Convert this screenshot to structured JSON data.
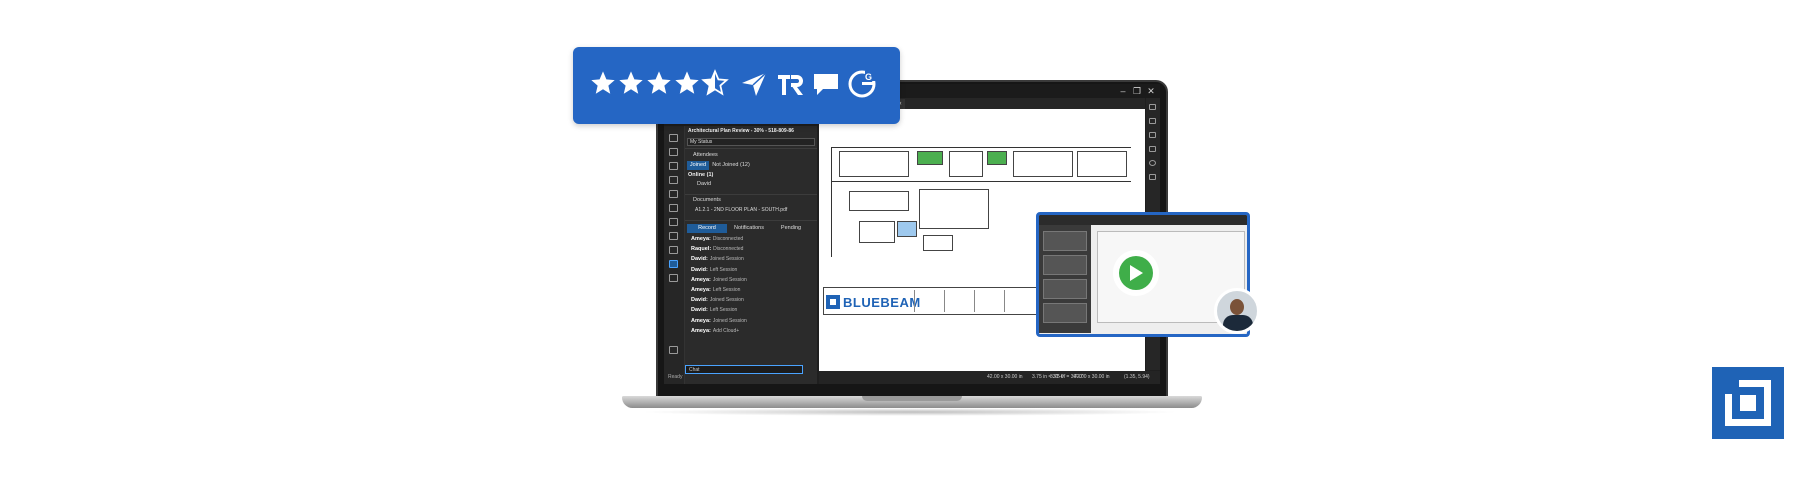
{
  "app": {
    "session_title": "Architectural Plan Review - 30% - 518-809-86",
    "status_label": "My Status",
    "status_text": "Ready"
  },
  "attendees": {
    "header": "Attendees",
    "tabs": [
      "Joined",
      "Not Joined (12)"
    ],
    "online_header": "Online (1)",
    "online_users": [
      "David"
    ]
  },
  "documents": {
    "header": "Documents",
    "items": [
      "A1.2.1 - 2ND FLOOR PLAN - SOUTH.pdf"
    ]
  },
  "record": {
    "tabs": [
      "Record",
      "Notifications",
      "Pending"
    ],
    "entries": [
      {
        "name": "Ameya:",
        "action": "Disconnected"
      },
      {
        "name": "Raquel:",
        "action": "Disconnected"
      },
      {
        "name": "David:",
        "action": "Joined Session"
      },
      {
        "name": "David:",
        "action": "Left Session"
      },
      {
        "name": "Ameya:",
        "action": "Joined Session"
      },
      {
        "name": "Ameya:",
        "action": "Left Session"
      },
      {
        "name": "David:",
        "action": "Joined Session"
      },
      {
        "name": "David:",
        "action": "Left Session"
      },
      {
        "name": "Ameya:",
        "action": "Joined Session"
      },
      {
        "name": "Ameya:",
        "action": "Add Cloud+"
      }
    ]
  },
  "chat": {
    "placeholder": "Chat"
  },
  "bottom": {
    "dimensions_1": "42.00 x 30.00 in",
    "scale_1": "3.75 in = 30'-0\"",
    "scale_2": "3.75 in = 30'-0\"",
    "dimensions_2": "42.00 x 30.00 in",
    "coords": "(1.35, 5.94)"
  },
  "brand": {
    "logo_text": "BLUEBEAM",
    "accent": "#2566c4",
    "logo_blue": "#1f63b6",
    "play_green": "#3fae49"
  },
  "rating": {
    "stars": 4.5,
    "max": 5,
    "icons": [
      "capterra-icon",
      "trustradius-icon",
      "software-advice-icon",
      "g2-icon"
    ],
    "g2_label": "G"
  }
}
